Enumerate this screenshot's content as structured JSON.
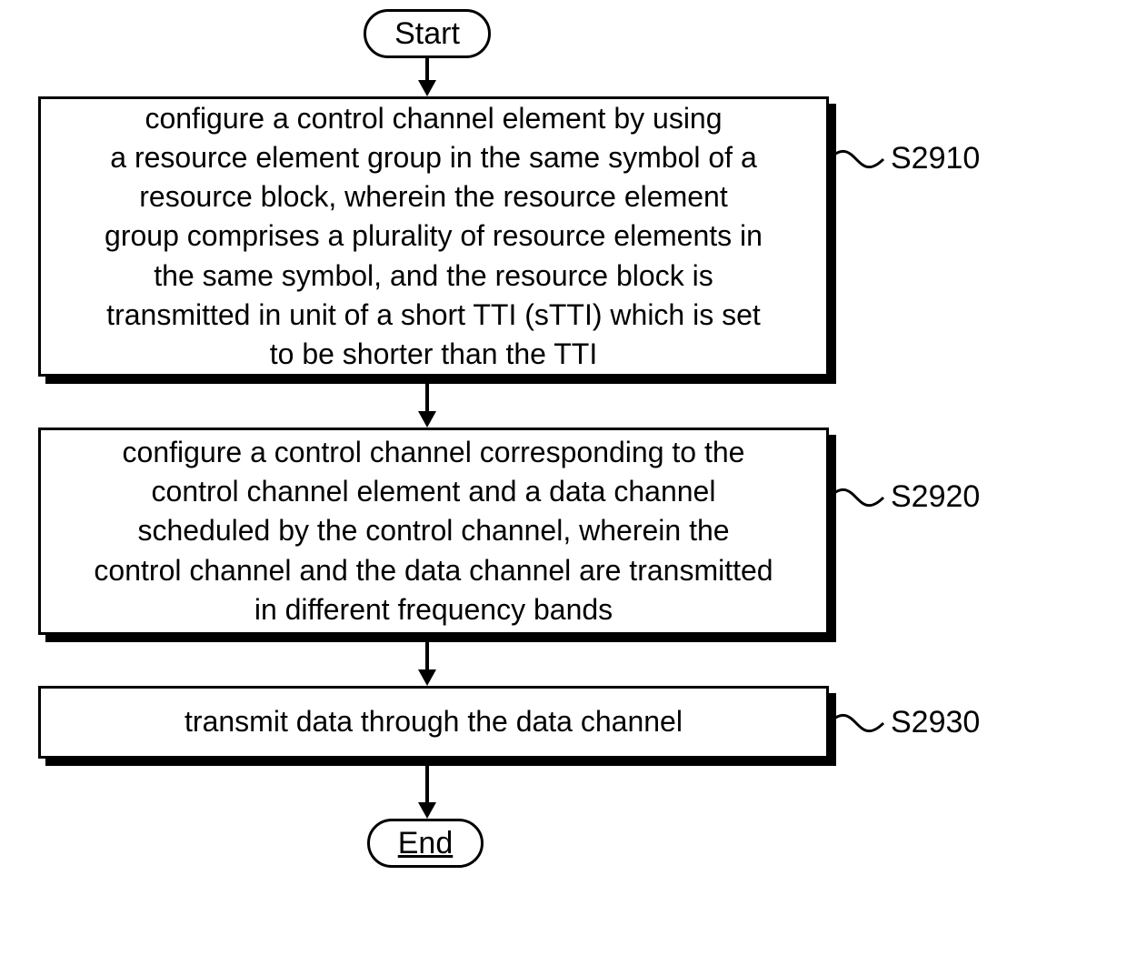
{
  "chart_data": {
    "type": "flowchart",
    "nodes": [
      {
        "id": "start",
        "kind": "terminator",
        "text": "Start"
      },
      {
        "id": "s2910",
        "kind": "process",
        "label": "S2910",
        "text": "configure a control channel element by using a resource element group in the same symbol of a resource block, wherein the resource element group comprises a plurality of resource elements in the same symbol, and the resource block is transmitted in unit of a short TTI (sTTI) which is set to be shorter than the TTI"
      },
      {
        "id": "s2920",
        "kind": "process",
        "label": "S2920",
        "text": "configure a control channel corresponding to the control channel element and a data channel scheduled by the control channel, wherein the control channel and the data channel are transmitted in different frequency bands"
      },
      {
        "id": "s2930",
        "kind": "process",
        "label": "S2930",
        "text": "transmit data through the data channel"
      },
      {
        "id": "end",
        "kind": "terminator",
        "text": "End"
      }
    ],
    "edges": [
      {
        "from": "start",
        "to": "s2910"
      },
      {
        "from": "s2910",
        "to": "s2920"
      },
      {
        "from": "s2920",
        "to": "s2930"
      },
      {
        "from": "s2930",
        "to": "end"
      }
    ]
  },
  "start": {
    "text": "Start"
  },
  "end": {
    "text": "End"
  },
  "step1": {
    "label": "S2910",
    "text": "configure a control channel element by using\na resource element group in the same symbol of a\nresource block, wherein the resource element\ngroup comprises a plurality of resource elements in\nthe same symbol, and the resource block is\ntransmitted in unit of a short TTI (sTTI) which is set\nto be shorter than the TTI"
  },
  "step2": {
    "label": "S2920",
    "text": "configure a control channel corresponding to the\ncontrol channel element and a data channel\nscheduled by the control channel, wherein the\ncontrol channel and the data channel are transmitted\nin different frequency bands"
  },
  "step3": {
    "label": "S2930",
    "text": "transmit data through the data channel"
  }
}
